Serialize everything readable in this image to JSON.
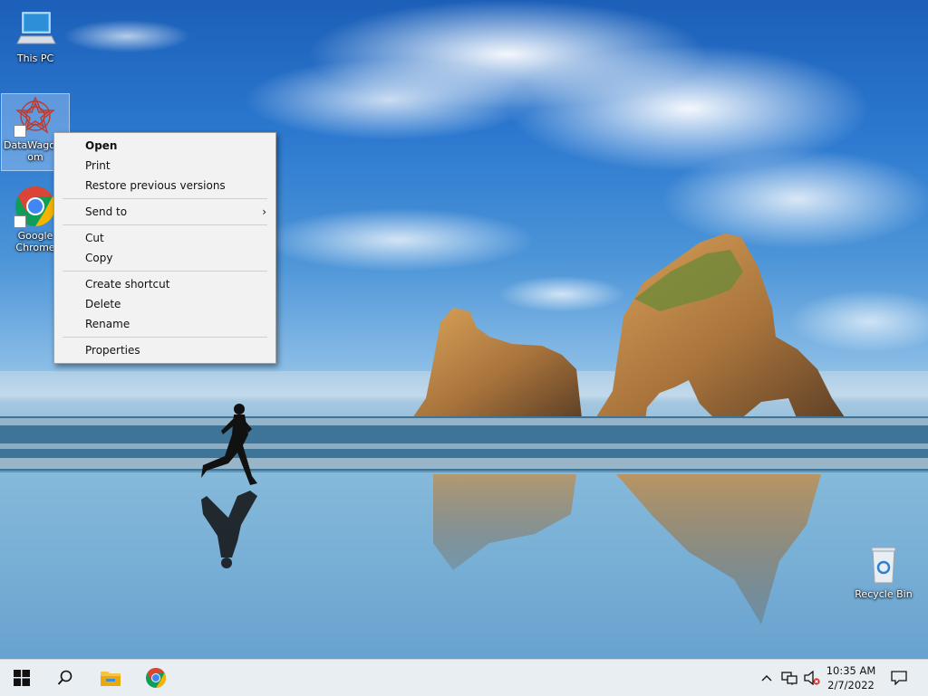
{
  "desktop": {
    "icons": [
      {
        "label": "This PC",
        "icon": "this-pc-icon"
      },
      {
        "label": "DataWagon.com",
        "label_line1": "DataWagonc",
        "label_line2": "om",
        "icon": "datawagon-icon",
        "selected": true
      },
      {
        "label": "Google Chrome",
        "label_line1": "Google",
        "label_line2": "Chrome",
        "icon": "chrome-icon"
      },
      {
        "label": "Recycle Bin",
        "icon": "recycle-bin-icon"
      }
    ]
  },
  "context_menu": {
    "items": [
      {
        "label": "Open",
        "bold": true
      },
      {
        "label": "Print"
      },
      {
        "label": "Restore previous versions"
      },
      {
        "label": "Send to",
        "submenu": true
      },
      {
        "label": "Cut"
      },
      {
        "label": "Copy"
      },
      {
        "label": "Create shortcut"
      },
      {
        "label": "Delete"
      },
      {
        "label": "Rename"
      },
      {
        "label": "Properties"
      }
    ],
    "submenu_arrow": "›"
  },
  "taskbar": {
    "start": "windows-start-icon",
    "search": "search-icon",
    "pinned": [
      "file-explorer-icon",
      "chrome-icon"
    ],
    "tray": {
      "chevron": "chevron-up-icon",
      "network": "network-icon",
      "volume": "volume-muted-icon",
      "time": "10:35 AM",
      "date": "2/7/2022",
      "notifications": "notification-icon"
    }
  },
  "colors": {
    "taskbar_bg": "#e9eef3",
    "menu_bg": "#f2f2f2",
    "chrome_red": "#db4437",
    "chrome_green": "#0f9d58",
    "chrome_yellow": "#f4b400",
    "chrome_blue": "#4285f4"
  }
}
